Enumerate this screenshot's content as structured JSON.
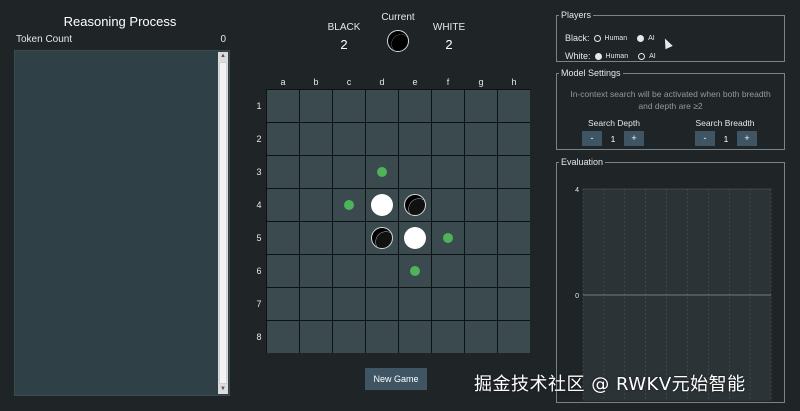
{
  "reasoning": {
    "title": "Reasoning Process",
    "token_count_label": "Token Count",
    "token_count": "0"
  },
  "score": {
    "black_label": "BLACK",
    "black_count": "2",
    "current_label": "Current",
    "current_player": "black",
    "white_label": "WHITE",
    "white_count": "2"
  },
  "board": {
    "columns": [
      "a",
      "b",
      "c",
      "d",
      "e",
      "f",
      "g",
      "h"
    ],
    "rows": [
      "1",
      "2",
      "3",
      "4",
      "5",
      "6",
      "7",
      "8"
    ],
    "pieces": [
      {
        "col": "d",
        "row": "4",
        "color": "white"
      },
      {
        "col": "e",
        "row": "4",
        "color": "black"
      },
      {
        "col": "d",
        "row": "5",
        "color": "black"
      },
      {
        "col": "e",
        "row": "5",
        "color": "white"
      }
    ],
    "valid_moves": [
      {
        "col": "d",
        "row": "3"
      },
      {
        "col": "c",
        "row": "4"
      },
      {
        "col": "f",
        "row": "5"
      },
      {
        "col": "e",
        "row": "6"
      }
    ],
    "hint_color": "#4fb35a"
  },
  "new_game_label": "New Game",
  "players": {
    "legend": "Players",
    "black_label": "Black:",
    "white_label": "White:",
    "human_label": "Human",
    "ai_label": "AI",
    "black_selected": "AI",
    "white_selected": "Human"
  },
  "model_settings": {
    "legend": "Model Settings",
    "note": "In-context search will be activated when both breadth and depth are ≥2",
    "depth_label": "Search Depth",
    "depth_value": "1",
    "breadth_label": "Search Breadth",
    "breadth_value": "1",
    "minus": "-",
    "plus": "+"
  },
  "evaluation": {
    "legend": "Evaluation"
  },
  "chart_data": {
    "type": "line",
    "title": "",
    "xlabel": "",
    "ylabel": "",
    "y_ticks": [
      "4",
      "0"
    ],
    "ylim": [
      -4,
      4
    ],
    "series": [],
    "grid": true
  },
  "watermark": "掘金技术社区 @ RWKV元始智能",
  "colors": {
    "background": "#1f2427",
    "board_cell": "#3a4a4f",
    "board_grid": "#0e1214",
    "button": "#3f5563"
  }
}
